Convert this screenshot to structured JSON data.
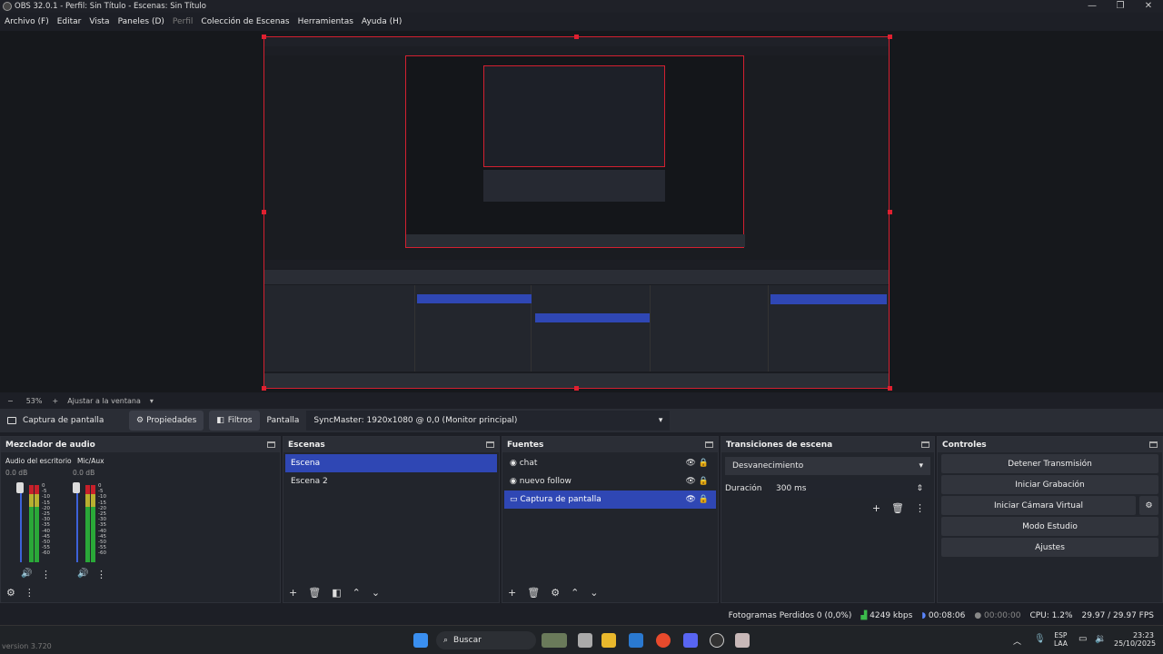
{
  "window": {
    "title": "OBS 32.0.1 - Perfil: Sin Título - Escenas: Sin Título"
  },
  "menu": [
    "Archivo (F)",
    "Editar",
    "Vista",
    "Paneles (D)",
    "Perfil",
    "Colección de Escenas",
    "Herramientas",
    "Ayuda (H)"
  ],
  "zoom": {
    "minus": "−",
    "value": "53%",
    "plus": "+",
    "fit": "Ajustar a la ventana"
  },
  "source_bar": {
    "source": "Captura de pantalla",
    "properties": "Propiedades",
    "filters": "Filtros",
    "display_label": "Pantalla",
    "display_value": "SyncMaster: 1920x1080 @ 0,0 (Monitor principal)"
  },
  "mixer": {
    "title": "Mezclador de audio",
    "channels": [
      {
        "name": "Audio del escritorio",
        "db": "0.0 dB"
      },
      {
        "name": "Mic/Aux",
        "db": "0.0 dB"
      }
    ],
    "scale": [
      "0",
      "-5",
      "-10",
      "-15",
      "-20",
      "-25",
      "-30",
      "-35",
      "-40",
      "-45",
      "-50",
      "-55",
      "-60"
    ]
  },
  "scenes": {
    "title": "Escenas",
    "items": [
      "Escena",
      "Escena 2"
    ]
  },
  "sources": {
    "title": "Fuentes",
    "items": [
      "chat",
      "nuevo follow",
      "Captura de pantalla"
    ]
  },
  "transitions": {
    "title": "Transiciones de escena",
    "type": "Desvanecimiento",
    "duration_label": "Duración",
    "duration_value": "300 ms"
  },
  "controls": {
    "title": "Controles",
    "stream": "Detener Transmisión",
    "record": "Iniciar Grabación",
    "vcam": "Iniciar Cámara Virtual",
    "studio": "Modo Estudio",
    "settings": "Ajustes"
  },
  "status": {
    "dropped": "Fotogramas Perdidos 0 (0,0%)",
    "bitrate": "4249 kbps",
    "stream_time": "00:08:06",
    "rec_time": "00:00:00",
    "cpu": "CPU: 1.2%",
    "fps": "29.97 / 29.97 FPS"
  },
  "taskbar": {
    "search": "Buscar",
    "lang1": "ESP",
    "lang2": "LAA",
    "time": "23:23",
    "date": "25/10/2025"
  },
  "version": "version 3.720"
}
